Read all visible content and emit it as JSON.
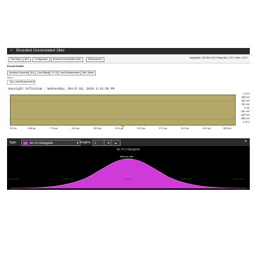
{
  "window": {
    "title": "Bounded Uncorrelated Jitter"
  },
  "meas_bar": {
    "chips": [
      "Test Setup",
      "BUJ",
      "Configuration",
      "Bounded Uncorrelated Jitter",
      "Measurement"
    ],
    "right_status": "Acquisition: 100 Wfm 100.0 Msps    Min: 1.00 V    Max: 1.00 V"
  },
  "result_details": {
    "heading": "Result Details",
    "buttons": [
      "Bounded Uncorrelated",
      "BUJ",
      "Level Between",
      "PJ, RJ",
      "Level Measurement",
      "Min: Saved"
    ],
    "label_caption": "Label 1",
    "label_value": "Type Label/Measurement"
  },
  "waveform": {
    "timestamp": "Keysight Infiniium : Wednesday, March 02, 2016 2:41:38 PM",
    "y_ticks": [
      "1.15 V",
      "856 mV",
      "563 mV",
      "281 mV",
      "0 mV",
      "-281 mV",
      "-563 mV",
      "-856 mV",
      "-1.15 V"
    ],
    "x_ticks": [
      "9.6 ns",
      "3.88 µs",
      "7.76 µs",
      "11.6 µs",
      "15.5 µs",
      "19.4 µs",
      "23.3 µs",
      "27.2 µs",
      "31.0 µs",
      "34.9 µs",
      "38.8 µs"
    ]
  },
  "histogram_bar": {
    "type_label": "Type",
    "type_value": "B1 PJ Histogram",
    "graphs_label": "Graphs",
    "graphs_value": "1",
    "close": "×"
  },
  "histogram": {
    "title": "B1 PJ Histogram",
    "peak_label": "Maximum 281",
    "color": "#e040e8",
    "x_ticks": [
      "-10.00 mUI",
      "-5.000 mUI",
      "0.0 UI",
      "5.000 mUI",
      "10.00 mUI"
    ]
  }
}
